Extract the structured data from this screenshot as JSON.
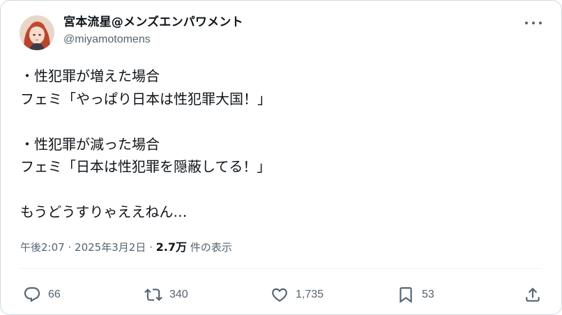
{
  "tweet": {
    "author": {
      "display_name": "宮本流星@メンズエンパワメント",
      "handle": "@miyamotomens"
    },
    "text": "・性犯罪が増えた場合\nフェミ「やっぱり日本は性犯罪大国！」\n\n・性犯罪が減った場合\nフェミ「日本は性犯罪を隠蔽してる！」\n\nもうどうすりゃええねん…",
    "meta": {
      "time": "午後2:07",
      "sep1": "·",
      "date": "2025年3月2日",
      "sep2": "·",
      "views_count": "2.7万",
      "views_label": " 件の表示"
    },
    "actions": {
      "replies": "66",
      "retweets": "340",
      "likes": "1,735",
      "bookmarks": "53"
    }
  },
  "icons": {
    "more": "more-horizontal-icon",
    "reply": "reply-icon",
    "retweet": "retweet-icon",
    "like": "heart-icon",
    "bookmark": "bookmark-icon",
    "share": "share-icon"
  },
  "colors": {
    "text": "#0f1419",
    "secondary": "#536471",
    "border": "#cfd9de"
  }
}
